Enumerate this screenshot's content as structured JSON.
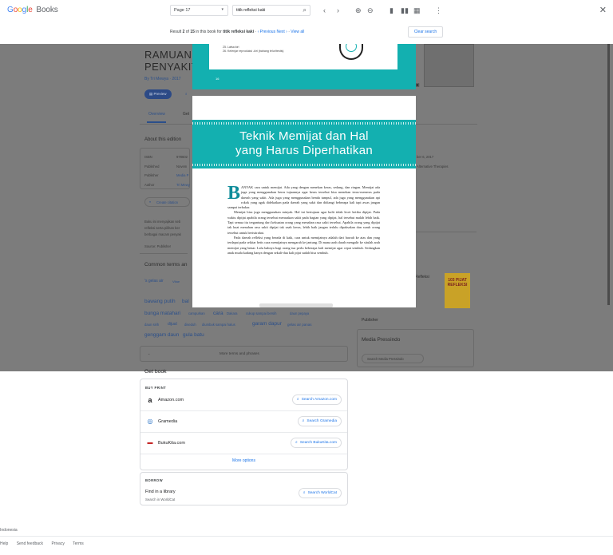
{
  "app": {
    "logo_google": "Google",
    "logo_books": "Books"
  },
  "toolbar": {
    "page_select_value": "Page 17",
    "search_value": "titik refleksi kaki",
    "icons": [
      "search-icon",
      "chevron-left-icon",
      "chevron-right-icon",
      "zoom-in-icon",
      "zoom-out-icon",
      "single-page-icon",
      "two-page-icon",
      "thumbnails-icon",
      "more-vert-icon",
      "close-icon"
    ]
  },
  "result_bar": {
    "prefix": "Result",
    "current": "2",
    "of": "of",
    "total": "15",
    "middle": "in this book for",
    "query": "titik refleksi kaki",
    "previous": "‹ Previous",
    "next": "Next ›",
    "view_all": "View all",
    "clear_button": "Clear search"
  },
  "background_page": {
    "title_line1": "RAMUAN",
    "title_line2": "PENYAKIT",
    "author": "By Tri Mewya · 2017",
    "preview_chip": "Preview",
    "tabs": {
      "overview": "Overview",
      "get": "Get"
    },
    "about_heading": "About this edition",
    "fields": {
      "isbn_label": "ISBN",
      "isbn_value": "978602",
      "published_label": "Published",
      "published_value": "Novem",
      "publisher_label": "Publisher",
      "publisher_value": "Media P",
      "author_label": "Author",
      "author_value": "Tri Mewy",
      "right_date": "ber 6, 2017",
      "right_category": "Alternative Therapies"
    },
    "create_citation": "Create citation",
    "desc_lines": [
      "Buku ini menyajikan seb",
      "refleksi serta pilihan ber",
      "berbagai macam penyak"
    ],
    "source": "Source: Publisher",
    "common_terms_heading": "Common terms an",
    "terms": [
      "'s gelas air",
      "Vitae",
      "bawang putih",
      "bal",
      "bunga matahari",
      "campurkan",
      "cara",
      "Dakara",
      "cukup sampai bersih",
      "daun pepaya",
      "daun sirih",
      "dijual",
      "diseduh",
      "diumbuk sampai halus",
      "garam dapur",
      "gelas air panas",
      "genggam daun",
      "gula batu"
    ],
    "more_terms": "More terms and phrases",
    "related_label": "Refleksi",
    "related_cover_title": "103 PIJAT REFLEKSI",
    "publisher_heading": "Publisher",
    "publisher_name": "Media Pressindo",
    "search_publisher": "Search Media Pressindo"
  },
  "open_page": {
    "prev_list": [
      "25. Latsa kiri",
      "26. Kelenjar reproduksi -kiri (bahang telur/testis)"
    ],
    "prev_page_number": "16",
    "chapter_title_line1": "Teknik Memijat dan Hal",
    "chapter_title_line2": "yang Harus Diperhatikan",
    "drop_cap": "B",
    "paragraph1": "ANYAK cara untuk memijat. Ada yang dengan menekan keras, sedang, dan ringan. Memijat ada juga yang menggunakan beras tujuannya agar beras tersebut bisa menekan terus-menerus pada daerah yang sakit. Ada juga yang menggunakan benda tumpul, ada juga yang menggunakan api rokok yang agak didekatkan pada daerah yang sakit dan didiangi beberapa kali tapi awas jangan sampai terbakar.",
    "paragraph2": "Memijat bisa juga menggunakan minyak. Hal ini bertujuan agar kulit tidak lecet ketika dipijat. Pada waktu dipijat apabila orang tersebut merasakan sakit pada bagian yang dipijat, hal tersebut malah lebih baik. Tapi semua itu tergantung dari kekuatan orang yang menahan rasa sakit tersebut. Apabila orang yang dipijat tak kuat menahan rasa sakit dipijat tak usah keras, lebih baik jangan terlalu dipaksakan dan suruh orang tersebut untuk beristirahat.",
    "paragraph3": "Pada daerah refleksi yang berada di kaki, cara untuk memijatnya adalah dari bawah ke atas dan yang terdapat pada sekitar betis cara memijatnya mengarah ke jantung. Di mana arah darah mengalir ke situlah arah memijat yang benar. Lalu bahnya bagi orang tua perlu beberapa kali memijat agar cepat sembuh. Sedangkan anak muda kadang hanya dengan sekali-dua kali pijat sudah bisa sembuh."
  },
  "get_book": {
    "heading": "Get book",
    "buy_label": "BUY PRINT",
    "stores": [
      {
        "name": "Amazon.com",
        "button": "Search Amazon.com",
        "icon": "amazon-icon"
      },
      {
        "name": "Gramedia",
        "button": "Search Gramedia",
        "icon": "gramedia-icon"
      },
      {
        "name": "BukuKita.com",
        "button": "Search BukuKita.com",
        "icon": "bukukita-icon"
      }
    ],
    "more_options": "More options",
    "borrow_label": "BORROW",
    "library_title": "Find in a library",
    "library_sub": "Search in WorldCat",
    "library_button": "Search WorldCat"
  },
  "footer": {
    "language": "Indonesia",
    "links": [
      "Help",
      "Send feedback",
      "Privacy",
      "Terms"
    ]
  },
  "colors": {
    "teal": "#13b0b0",
    "link_blue": "#1a73e8",
    "overlay": "#7c7c7c"
  }
}
